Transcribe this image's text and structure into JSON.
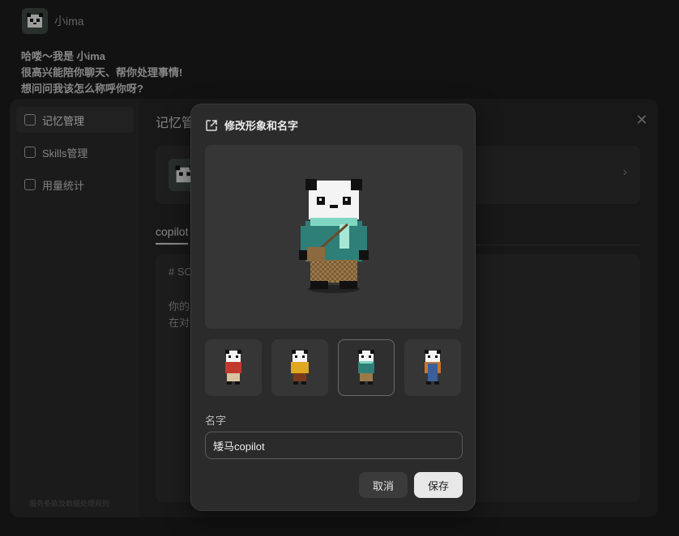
{
  "chat": {
    "assistant_name": "小ima",
    "greeting": [
      "哈喽～我是 小ima",
      "很高兴能陪你聊天、帮你处理事情!",
      "想问问我该怎么称呼你呀?"
    ]
  },
  "settings": {
    "close_label": "✕",
    "nav": [
      {
        "label": "记忆管理",
        "icon": "memory-icon",
        "active": true
      },
      {
        "label": "Skills管理",
        "icon": "skills-icon",
        "active": false
      },
      {
        "label": "用量统计",
        "icon": "usage-icon",
        "active": false
      }
    ],
    "footer": "服务条款及数据处理规则",
    "content_title": "记忆管",
    "tab_label": "copilot",
    "doc_lines": [
      "# SO",
      "",
      "你的",
      "在对"
    ]
  },
  "modal": {
    "title": "修改形象和名字",
    "name_label": "名字",
    "name_value": "矮马copilot",
    "cancel_label": "取消",
    "save_label": "保存",
    "avatar_options": [
      {
        "outfit": "red-jacket",
        "selected": false
      },
      {
        "outfit": "yellow-sweater",
        "selected": false
      },
      {
        "outfit": "teal-sweater-scarf",
        "selected": true
      },
      {
        "outfit": "blue-overalls",
        "selected": false
      }
    ]
  },
  "colors": {
    "background": "#1c1c1c",
    "modal_bg": "#2b2b2b",
    "save_button": "#e8e8e8",
    "panda_scarf": "#7fd6c2",
    "panda_sweater": "#2e7f78"
  }
}
